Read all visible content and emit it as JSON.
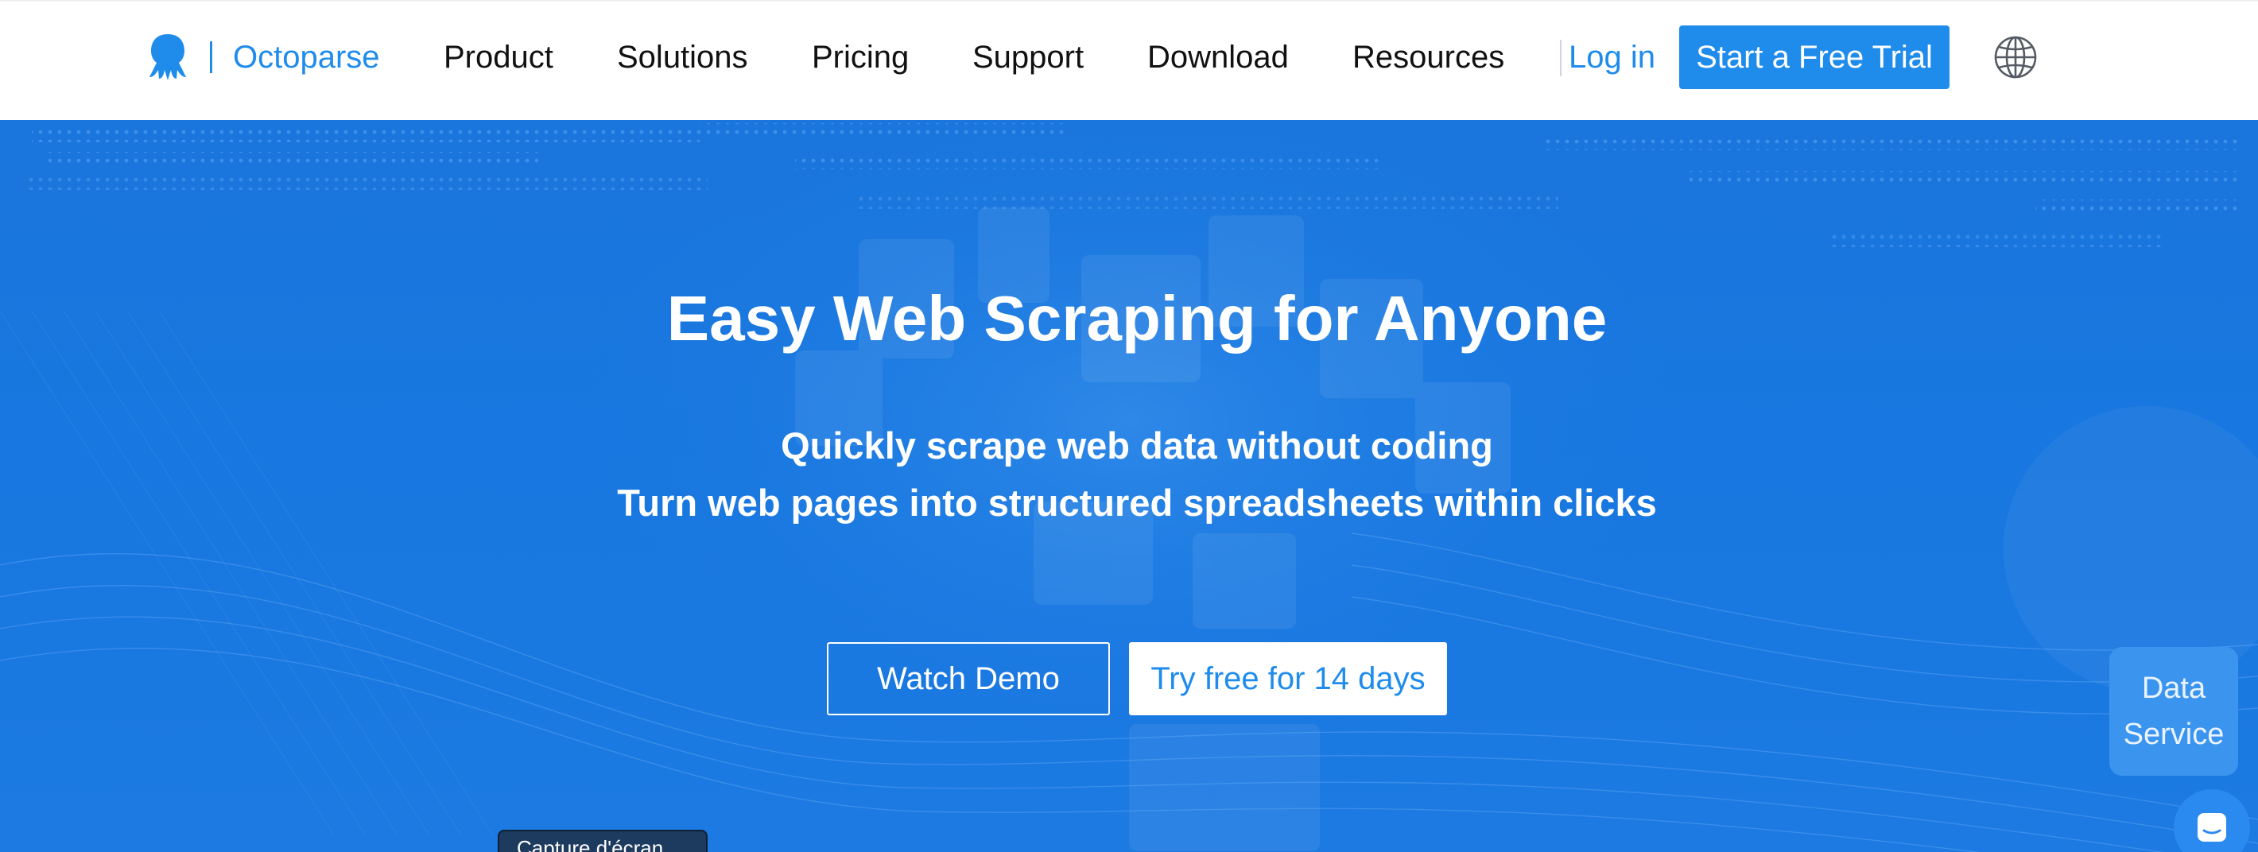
{
  "brand": {
    "name": "Octoparse",
    "accent_color": "#1f8ceb",
    "logo_icon": "octopus-icon"
  },
  "nav": {
    "items": [
      "Product",
      "Solutions",
      "Pricing",
      "Support",
      "Download",
      "Resources"
    ],
    "login_label": "Log in",
    "trial_label": "Start a Free Trial",
    "language_icon": "globe-icon"
  },
  "hero": {
    "title": "Easy Web Scraping for Anyone",
    "subtitle_line1": "Quickly scrape web data without coding",
    "subtitle_line2": "Turn web pages into structured spreadsheets within clicks",
    "watch_demo_label": "Watch Demo",
    "try_free_label": "Try free for 14 days",
    "background_color": "#1877e0"
  },
  "widgets": {
    "data_service_line1": "Data",
    "data_service_line2": "Service",
    "chat_icon": "chat-icon",
    "screenshot_tooltip": "Capture d'écran"
  }
}
